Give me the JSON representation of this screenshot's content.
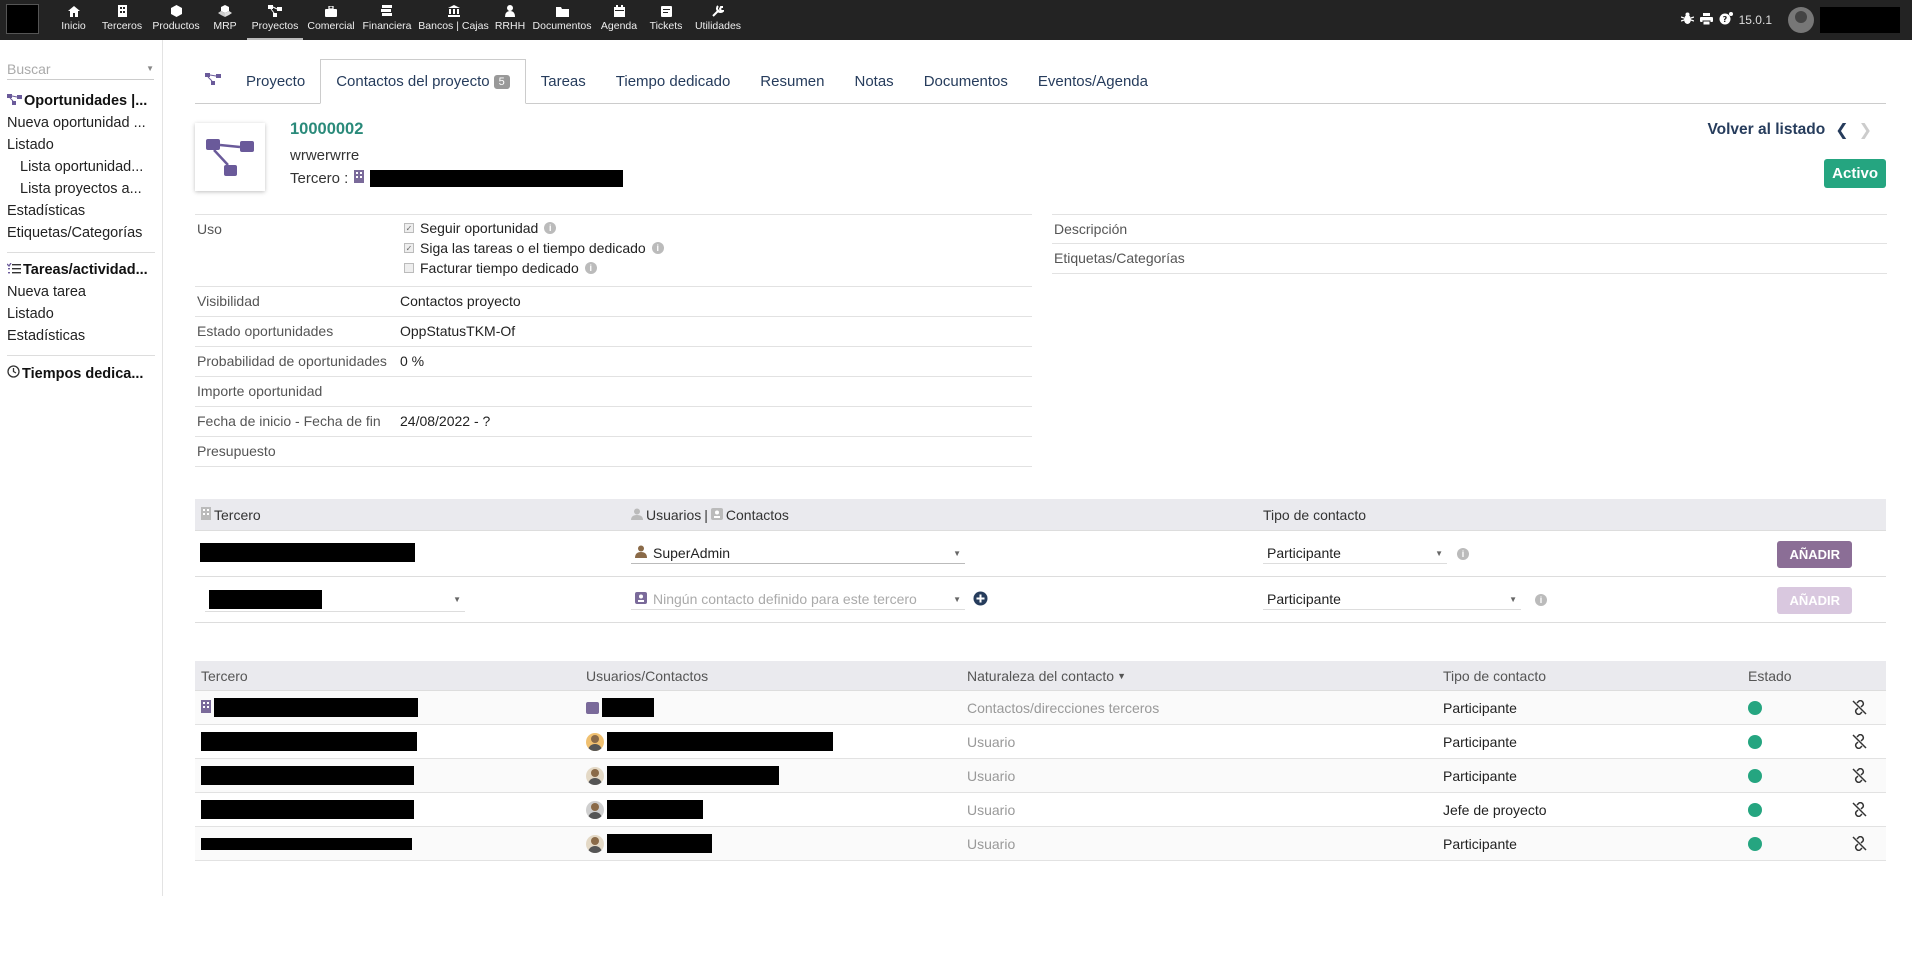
{
  "topbar": {
    "menu": [
      {
        "label": "Inicio",
        "icon": "home-icon"
      },
      {
        "label": "Terceros",
        "icon": "building-icon"
      },
      {
        "label": "Productos",
        "icon": "cube-icon"
      },
      {
        "label": "MRP",
        "icon": "cubes-icon"
      },
      {
        "label": "Proyectos",
        "icon": "project-icon"
      },
      {
        "label": "Comercial",
        "icon": "suitcase-icon"
      },
      {
        "label": "Financiera",
        "icon": "money-icon"
      },
      {
        "label": "Bancos | Cajas",
        "icon": "bank-icon"
      },
      {
        "label": "RRHH",
        "icon": "user-icon"
      },
      {
        "label": "Documentos",
        "icon": "folder-icon"
      },
      {
        "label": "Agenda",
        "icon": "calendar-icon"
      },
      {
        "label": "Tickets",
        "icon": "ticket-icon"
      },
      {
        "label": "Utilidades",
        "icon": "wrench-icon"
      }
    ],
    "version": "15.0.1"
  },
  "leftmenu": {
    "search_placeholder": "Buscar",
    "opp_title": "Oportunidades |...",
    "opp_items": [
      {
        "label": "Nueva oportunidad ...",
        "sub": false
      },
      {
        "label": "Listado",
        "sub": false
      },
      {
        "label": "Lista oportunidad...",
        "sub": true
      },
      {
        "label": "Lista proyectos a...",
        "sub": true
      },
      {
        "label": "Estadísticas",
        "sub": false
      },
      {
        "label": "Etiquetas/Categorías",
        "sub": false
      }
    ],
    "tasks_title": "Tareas/actividad...",
    "task_items": [
      "Nueva tarea",
      "Listado",
      "Estadísticas"
    ],
    "time_title": "Tiempos dedica..."
  },
  "tabs": {
    "items": [
      "Proyecto",
      "Contactos del proyecto",
      "Tareas",
      "Tiempo dedicado",
      "Resumen",
      "Notas",
      "Documentos",
      "Eventos/Agenda"
    ],
    "contacts_count": "5"
  },
  "banner": {
    "ref": "10000002",
    "label": "wrwerwrre",
    "tercero_label": "Tercero :",
    "back_label": "Volver al listado",
    "status": "Activo"
  },
  "fields_left": {
    "uso_label": "Uso",
    "uso_checks": [
      "Seguir oportunidad",
      "Siga las tareas o el tiempo dedicado",
      "Facturar tiempo dedicado"
    ],
    "visibilidad_label": "Visibilidad",
    "visibilidad_value": "Contactos proyecto",
    "estado_label": "Estado oportunidades",
    "estado_value": "OppStatusTKM-Of",
    "prob_label": "Probabilidad de oportunidades",
    "prob_value": "0 %",
    "importe_label": "Importe oportunidad",
    "importe_value": "",
    "fechas_label": "Fecha de inicio - Fecha de fin",
    "fechas_value": "24/08/2022 - ?",
    "presupuesto_label": "Presupuesto",
    "presupuesto_value": ""
  },
  "fields_right": {
    "descripcion_label": "Descripción",
    "etiquetas_label": "Etiquetas/Categorías"
  },
  "addtable": {
    "col_tercero": "Tercero",
    "col_usuarios": "Usuarios",
    "col_sep": "|",
    "col_contactos": "Contactos",
    "col_tipo": "Tipo de contacto",
    "row1_user": "SuperAdmin",
    "row1_tipo": "Participante",
    "row2_placeholder": "Ningún contacto definido para este tercero",
    "row2_tipo": "Participante",
    "add_label": "AÑADIR"
  },
  "contactlist": {
    "headers": [
      "Tercero",
      "Usuarios/Contactos",
      "Naturaleza del contacto",
      "Tipo de contacto",
      "Estado"
    ],
    "rows": [
      {
        "naturaleza": "Contactos/direcciones terceros",
        "tipo": "Participante"
      },
      {
        "naturaleza": "Usuario",
        "tipo": "Participante"
      },
      {
        "naturaleza": "Usuario",
        "tipo": "Participante"
      },
      {
        "naturaleza": "Usuario",
        "tipo": "Jefe de proyecto"
      },
      {
        "naturaleza": "Usuario",
        "tipo": "Participante"
      }
    ]
  },
  "colors": {
    "topbar": "#232323",
    "accent_teal": "#2a8a7a",
    "status_green": "#25a580",
    "add_button": "#8b6e96",
    "tab_text": "#263c5c"
  }
}
